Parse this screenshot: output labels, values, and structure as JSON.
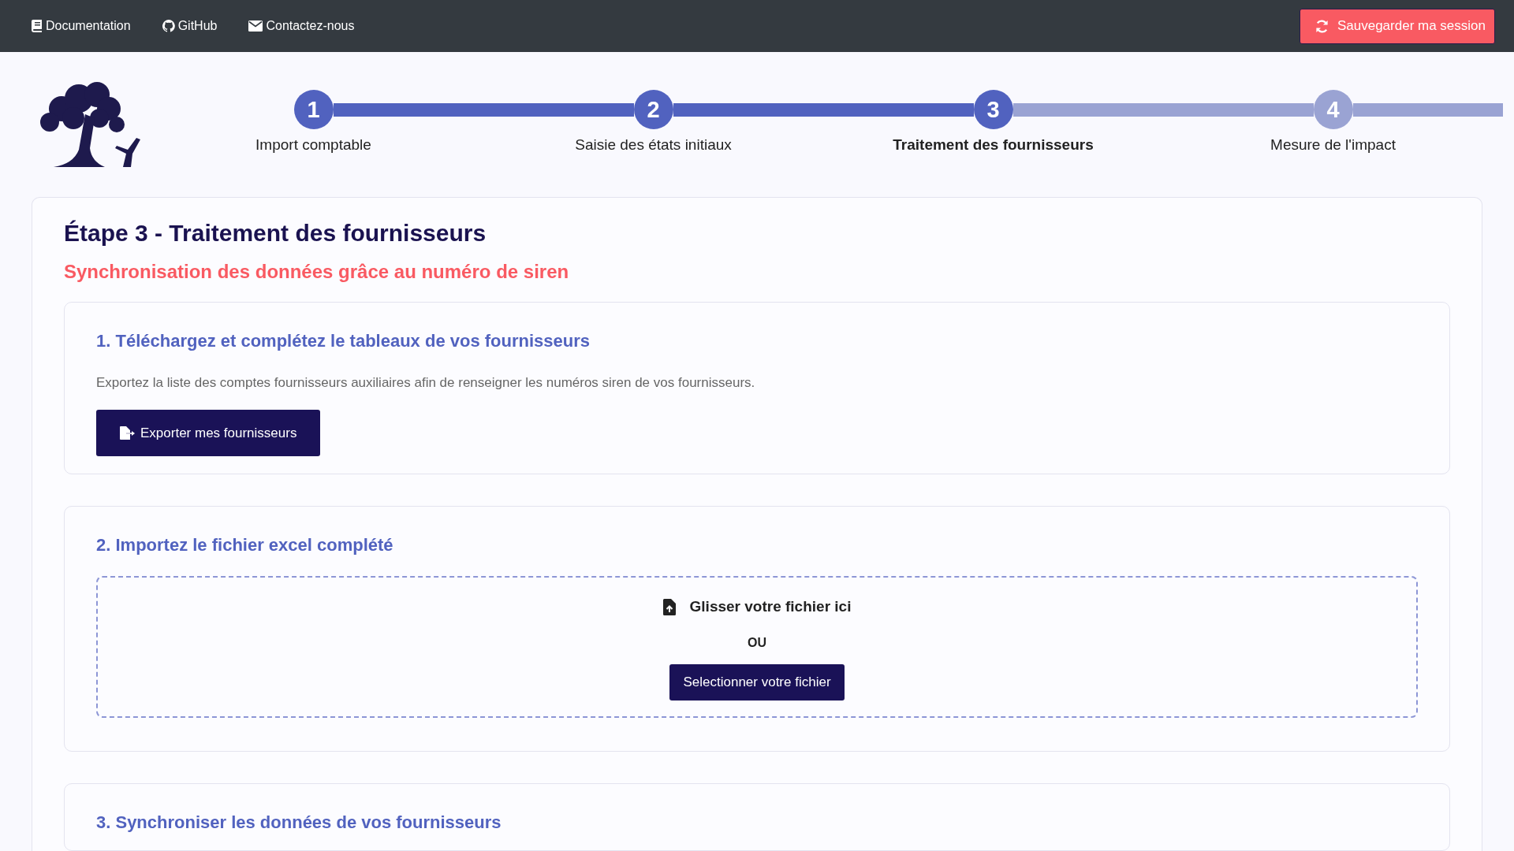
{
  "top_bar": {
    "links": [
      {
        "kind": "book",
        "label": "Documentation"
      },
      {
        "kind": "github",
        "label": "GitHub"
      },
      {
        "kind": "mail",
        "label": "Contactez-nous"
      }
    ],
    "save_button": "Sauvegarder ma session"
  },
  "steps": [
    {
      "number": "1",
      "label": "Import comptable",
      "reached": true,
      "selected": false
    },
    {
      "number": "2",
      "label": "Saisie des états initiaux",
      "reached": true,
      "selected": false
    },
    {
      "number": "3",
      "label": "Traitement des fournisseurs",
      "reached": true,
      "selected": true
    },
    {
      "number": "4",
      "label": "Mesure de l'impact",
      "reached": false,
      "selected": false
    }
  ],
  "page": {
    "title": "Étape 3 - Traitement des fournisseurs",
    "subtitle": "Synchronisation des données grâce au numéro de siren",
    "sections": [
      {
        "kind": "export",
        "title": "1. Téléchargez et complétez le tableaux de vos fournisseurs",
        "text": "Exportez la liste des comptes fournisseurs auxiliaires afin de renseigner les numéros siren de vos fournisseurs.",
        "button": "Exporter mes fournisseurs"
      },
      {
        "kind": "dropzone",
        "title": "2. Importez le fichier excel complété",
        "drop_text": "Glisser votre fichier ici",
        "or_text": "OU",
        "button": "Selectionner votre fichier"
      },
      {
        "kind": "title_only",
        "title": "3. Synchroniser les données de vos fournisseurs"
      }
    ]
  }
}
